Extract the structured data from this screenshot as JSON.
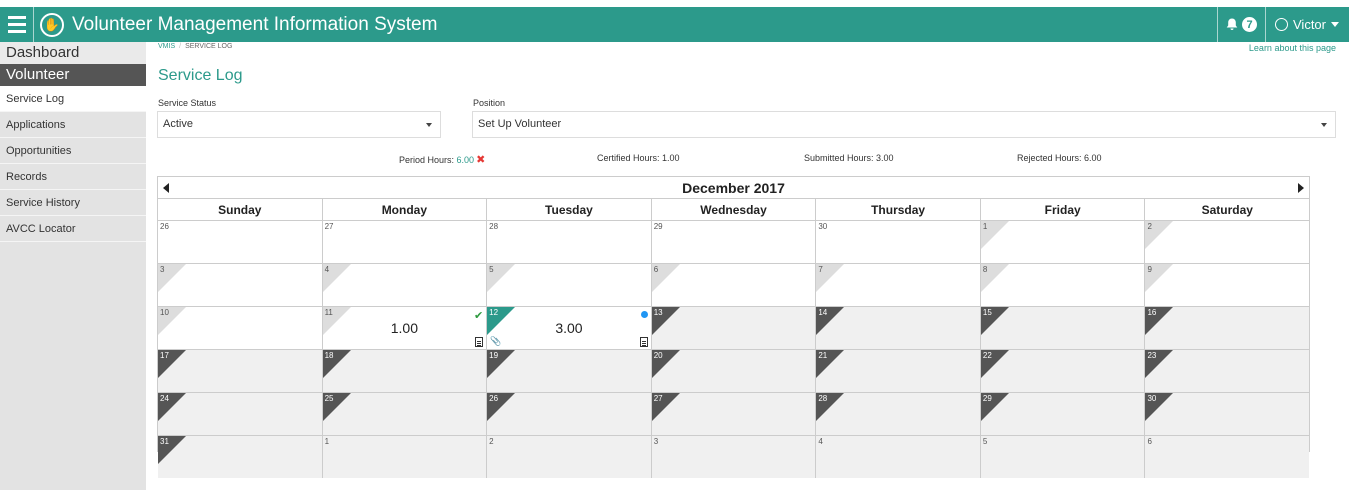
{
  "app": {
    "title": "Volunteer Management Information System",
    "notification_count": "7",
    "user_name": "Victor",
    "colors": {
      "primary": "#2c9a8b",
      "sidebar_bg": "#e3e3e3",
      "active_section": "#555555",
      "error": "#e53935",
      "success": "#2e9a3e",
      "info": "#2196f3"
    }
  },
  "sidebar": {
    "dashboard": "Dashboard",
    "section": "Volunteer",
    "items": [
      {
        "label": "Service Log"
      },
      {
        "label": "Applications"
      },
      {
        "label": "Opportunities"
      },
      {
        "label": "Records"
      },
      {
        "label": "Service History"
      },
      {
        "label": "AVCC Locator"
      }
    ]
  },
  "breadcrumb": {
    "root": "VMIS",
    "separator": "/",
    "current": "SERVICE LOG"
  },
  "help_link": "Learn about this page",
  "page_title": "Service Log",
  "filters": {
    "status_label": "Service Status",
    "status_value": "Active",
    "position_label": "Position",
    "position_value": "Set Up Volunteer"
  },
  "hours": {
    "period_label": "Period Hours:",
    "period_value": "6.00",
    "certified": "Certified Hours: 1.00",
    "submitted": "Submitted Hours: 3.00",
    "rejected": "Rejected Hours: 6.00"
  },
  "calendar": {
    "month_label": "December 2017",
    "weekdays": [
      "Sunday",
      "Monday",
      "Tuesday",
      "Wednesday",
      "Thursday",
      "Friday",
      "Saturday"
    ],
    "weeks": [
      [
        "26",
        "27",
        "28",
        "29",
        "30",
        "1",
        "2"
      ],
      [
        "3",
        "4",
        "5",
        "6",
        "7",
        "8",
        "9"
      ],
      [
        "10",
        "11",
        "12",
        "13",
        "14",
        "15",
        "16"
      ],
      [
        "17",
        "18",
        "19",
        "20",
        "21",
        "22",
        "23"
      ],
      [
        "24",
        "25",
        "26",
        "27",
        "28",
        "29",
        "30"
      ],
      [
        "31",
        "1",
        "2",
        "3",
        "4",
        "5",
        "6"
      ]
    ],
    "entries": {
      "monday_11": {
        "hours": "1.00",
        "status": "certified"
      },
      "tuesday_12": {
        "hours": "3.00",
        "status": "submitted"
      }
    }
  }
}
